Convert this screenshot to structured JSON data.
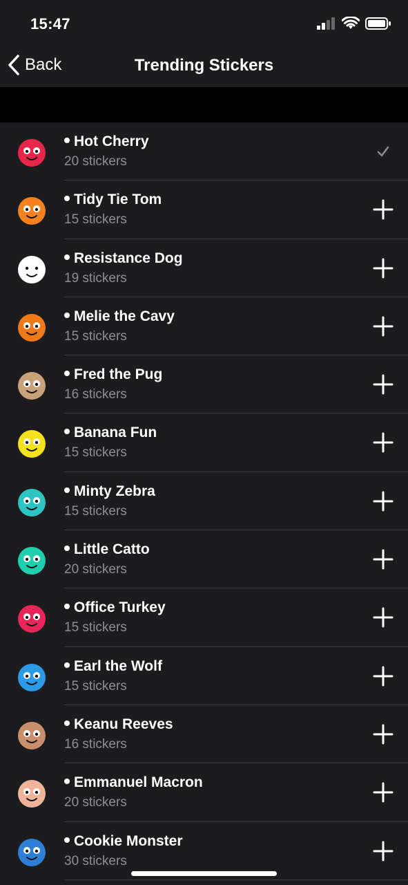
{
  "status": {
    "time": "15:47"
  },
  "nav": {
    "back_label": "Back",
    "title": "Trending Stickers"
  },
  "packs": [
    {
      "name": "Hot Cherry",
      "count": "20 stickers",
      "added": true,
      "icon": "cherry-sticker",
      "color": "#e8264a"
    },
    {
      "name": "Tidy Tie Tom",
      "count": "15 stickers",
      "added": false,
      "icon": "cat-sticker",
      "color": "#f5821f"
    },
    {
      "name": "Resistance Dog",
      "count": "19 stickers",
      "added": false,
      "icon": "dog-sticker",
      "color": "#ffffff"
    },
    {
      "name": "Melie the Cavy",
      "count": "15 stickers",
      "added": false,
      "icon": "guinea-pig-sticker",
      "color": "#f07a1a"
    },
    {
      "name": "Fred the Pug",
      "count": "16 stickers",
      "added": false,
      "icon": "pug-sticker",
      "color": "#c9a27a"
    },
    {
      "name": "Banana Fun",
      "count": "15 stickers",
      "added": false,
      "icon": "banana-sticker",
      "color": "#f5e11c"
    },
    {
      "name": "Minty Zebra",
      "count": "15 stickers",
      "added": false,
      "icon": "zebra-sticker",
      "color": "#2ec4c4"
    },
    {
      "name": "Little Catto",
      "count": "20 stickers",
      "added": false,
      "icon": "teal-cat-sticker",
      "color": "#1fcfb0"
    },
    {
      "name": "Office Turkey",
      "count": "15 stickers",
      "added": false,
      "icon": "turkey-sticker",
      "color": "#e8265a"
    },
    {
      "name": "Earl the Wolf",
      "count": "15 stickers",
      "added": false,
      "icon": "wolf-sticker",
      "color": "#2b9be8"
    },
    {
      "name": "Keanu Reeves",
      "count": "16 stickers",
      "added": false,
      "icon": "keanu-sticker",
      "color": "#c98e6a"
    },
    {
      "name": "Emmanuel Macron",
      "count": "20 stickers",
      "added": false,
      "icon": "macron-sticker",
      "color": "#f0b49a"
    },
    {
      "name": "Cookie Monster",
      "count": "30 stickers",
      "added": false,
      "icon": "cookie-monster-sticker",
      "color": "#2f7fd6"
    }
  ]
}
